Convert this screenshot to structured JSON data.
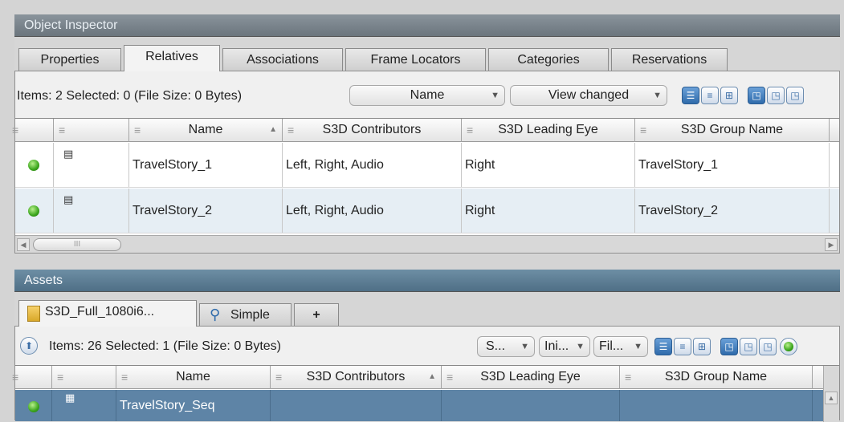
{
  "inspector": {
    "title": "Object Inspector",
    "tabs": [
      "Properties",
      "Relatives",
      "Associations",
      "Frame Locators",
      "Categories",
      "Reservations"
    ],
    "active_tab": "Relatives",
    "items_text": "Items: 2 Selected: 0 (File Size: 0 Bytes)",
    "sort_dropdown": "Name",
    "view_dropdown": "View changed",
    "columns": [
      "Name",
      "S3D Contributors",
      "S3D Leading Eye",
      "S3D Group Name"
    ],
    "rows": [
      {
        "name": "TravelStory_1",
        "contributors": "Left, Right, Audio",
        "leading_eye": "Right",
        "group": "TravelStory_1"
      },
      {
        "name": "TravelStory_2",
        "contributors": "Left, Right, Audio",
        "leading_eye": "Right",
        "group": "TravelStory_2"
      }
    ]
  },
  "assets": {
    "title": "Assets",
    "tabs": [
      "S3D_Full_1080i6...",
      "Simple",
      "+"
    ],
    "items_text": "Items: 26 Selected: 1 (File Size: 0 Bytes)",
    "filters": [
      "S...",
      "Ini...",
      "Fil..."
    ],
    "columns": [
      "Name",
      "S3D Contributors",
      "S3D Leading Eye",
      "S3D Group Name"
    ],
    "rows": [
      {
        "name": "TravelStory_Seq",
        "contributors": "",
        "leading_eye": "",
        "group": ""
      }
    ]
  },
  "icons": {
    "status": "green-status-dot-icon",
    "object": "group-object-icon",
    "sequence": "sequence-icon",
    "folder": "folder-icon",
    "search": "magnifier-icon",
    "up": "up-arrow-icon"
  },
  "colors": {
    "active_tab": "#f3f3f3",
    "selection": "#5e84a6",
    "accent": "#2f6bab",
    "status_green": "#3aa51c"
  }
}
